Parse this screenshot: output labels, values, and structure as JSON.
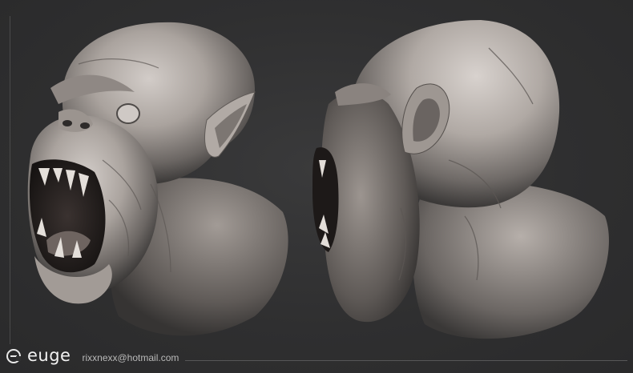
{
  "image": {
    "subject": "two views of a sculpted creature bust",
    "views": [
      {
        "id": "three-quarter-front",
        "label": ""
      },
      {
        "id": "side-profile",
        "label": ""
      }
    ]
  },
  "footer": {
    "logo_icon": "euge-logo-icon",
    "brand": "euge",
    "email": "rixxnexx@hotmail.com"
  },
  "colors": {
    "background": "#2f2f30",
    "clay": "#bdb6b1",
    "text": "#f2f2f2",
    "muted_text": "#b9b9b9"
  }
}
